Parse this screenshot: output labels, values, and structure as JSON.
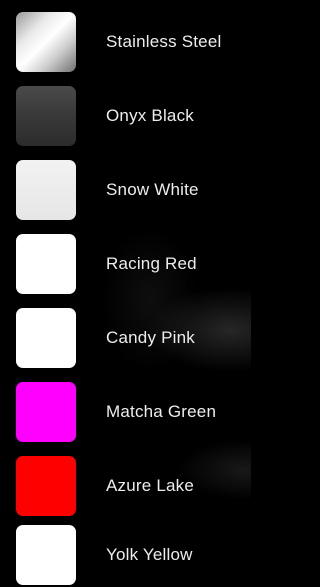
{
  "colors": [
    {
      "name": "Stainless Steel",
      "swatch": "gradient-steel"
    },
    {
      "name": "Onyx Black",
      "swatch": "#3a3a3a"
    },
    {
      "name": "Snow White",
      "swatch": "#e8e8e8"
    },
    {
      "name": "Racing Red",
      "swatch": "#ffffff"
    },
    {
      "name": "Candy Pink",
      "swatch": "#ffffff"
    },
    {
      "name": "Matcha Green",
      "swatch": "#ff00ff"
    },
    {
      "name": "Azure Lake",
      "swatch": "#ff0000"
    },
    {
      "name": "Yolk Yellow",
      "swatch": "#ffffff"
    }
  ]
}
